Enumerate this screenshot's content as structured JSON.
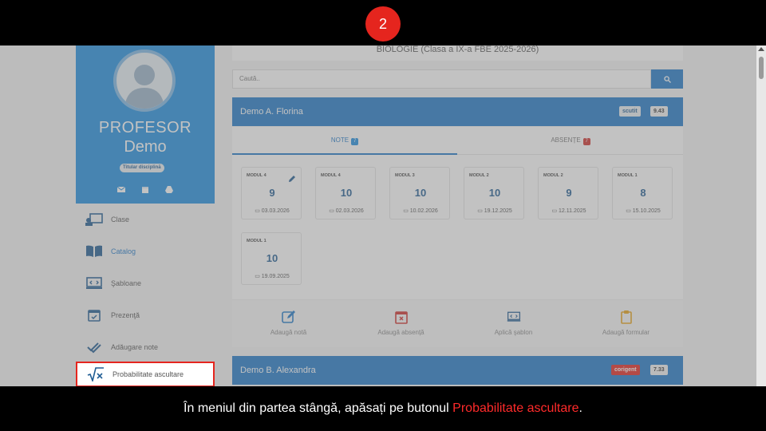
{
  "tutorial": {
    "step_number": "2",
    "caption_before": "În meniul din partea stângă, apăsați pe butonul ",
    "caption_highlight": "Probabilitate ascultare",
    "caption_after": "."
  },
  "profile": {
    "title": "PROFESOR",
    "name": "Demo",
    "badge": "Titular disciplină",
    "icons": [
      "envelope-icon",
      "calendar-icon",
      "drive-icon"
    ]
  },
  "menu": {
    "items": [
      {
        "label": "Clase",
        "icon": "classroom-icon"
      },
      {
        "label": "Catalog",
        "icon": "book-icon"
      },
      {
        "label": "Şabloane",
        "icon": "template-icon"
      },
      {
        "label": "Prezenţă",
        "icon": "calendar-check-icon"
      },
      {
        "label": "Adăugare note",
        "icon": "double-check-icon"
      },
      {
        "label": "Probabilitate ascultare",
        "icon": "square-root-icon"
      }
    ]
  },
  "main": {
    "subject_title": "BIOLOGIE (Clasa a IX-a FBE 2025-2026)",
    "search_placeholder": "Caută..",
    "students": [
      {
        "name": "Demo A. Florina",
        "status": "scutit",
        "average": "9.43",
        "tabs": [
          {
            "label": "NOTE",
            "count": "7"
          },
          {
            "label": "ABSENȚE",
            "count": "7"
          }
        ],
        "grades": [
          {
            "module": "MODUL 4",
            "value": "9",
            "date": "03.03.2026"
          },
          {
            "module": "MODUL 4",
            "value": "10",
            "date": "02.03.2026"
          },
          {
            "module": "MODUL 3",
            "value": "10",
            "date": "10.02.2026"
          },
          {
            "module": "MODUL 2",
            "value": "10",
            "date": "19.12.2025"
          },
          {
            "module": "MODUL 2",
            "value": "9",
            "date": "12.11.2025"
          },
          {
            "module": "MODUL 1",
            "value": "8",
            "date": "15.10.2025"
          },
          {
            "module": "MODUL 1",
            "value": "10",
            "date": "19.09.2025"
          }
        ],
        "actions": [
          {
            "label": "Adaugă notă",
            "icon": "edit-icon",
            "color": "#1f78c8"
          },
          {
            "label": "Adaugă absență",
            "icon": "calendar-x-icon",
            "color": "#d0312d"
          },
          {
            "label": "Aplică şablon",
            "icon": "template-icon",
            "color": "#1f5c93"
          },
          {
            "label": "Adaugă formular",
            "icon": "clipboard-icon",
            "color": "#e8a317"
          }
        ]
      },
      {
        "name": "Demo B. Alexandra",
        "status": "corigent",
        "average": "7.33"
      }
    ]
  },
  "colors": {
    "primary": "#1f78c8",
    "highlight": "#e5251e"
  }
}
